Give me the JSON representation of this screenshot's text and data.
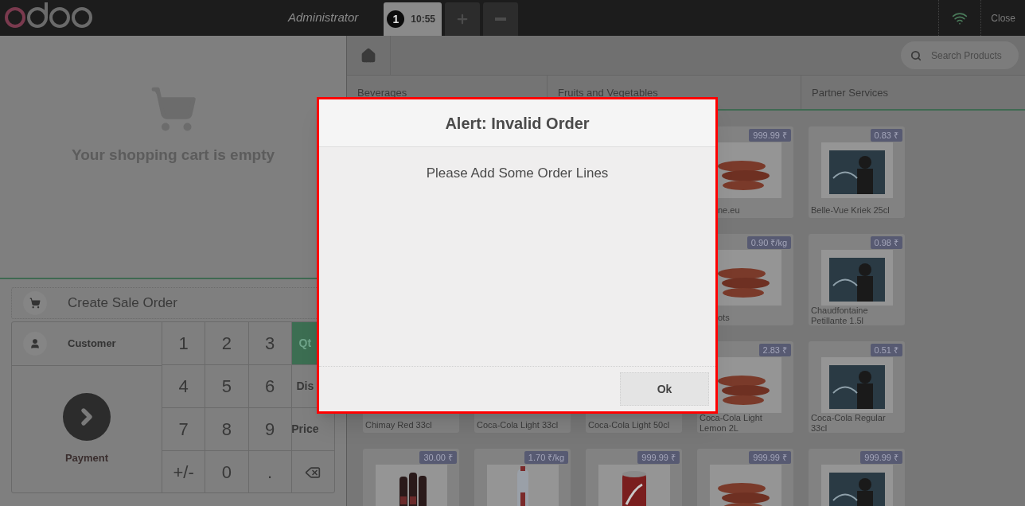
{
  "topbar": {
    "user": "Administrator",
    "orders": [
      {
        "number": "1",
        "time": "10:55",
        "selected": true
      }
    ],
    "close": "Close"
  },
  "cart": {
    "empty_message": "Your shopping cart is empty"
  },
  "actions": {
    "create_sale_order": "Create Sale Order",
    "customer": "Customer",
    "payment": "Payment"
  },
  "numpad": [
    {
      "kind": "key",
      "label": "1"
    },
    {
      "kind": "key",
      "label": "2"
    },
    {
      "kind": "key",
      "label": "3"
    },
    {
      "kind": "mode",
      "label": "Qt",
      "selected": true
    },
    {
      "kind": "key",
      "label": "4"
    },
    {
      "kind": "key",
      "label": "5"
    },
    {
      "kind": "key",
      "label": "6"
    },
    {
      "kind": "mode",
      "label": "Dis",
      "selected": false
    },
    {
      "kind": "key",
      "label": "7"
    },
    {
      "kind": "key",
      "label": "8"
    },
    {
      "kind": "key",
      "label": "9"
    },
    {
      "kind": "mode",
      "label": "Price",
      "selected": false
    },
    {
      "kind": "key",
      "label": "+/-"
    },
    {
      "kind": "key",
      "label": "0"
    },
    {
      "kind": "key",
      "label": "."
    },
    {
      "kind": "backspace"
    }
  ],
  "products_pane": {
    "search": {
      "placeholder": "Search Products"
    },
    "categories": [
      "Beverages",
      "Fruits and Vegetables",
      "Partner Services"
    ],
    "products": [
      {
        "kind": "covered"
      },
      {
        "kind": "covered"
      },
      {
        "kind": "covered"
      },
      {
        "kind": "partial",
        "price": "999.99 ₹",
        "name": "ne.eu"
      },
      {
        "kind": "card",
        "price": "0.83 ₹",
        "name": "Belle-Vue Kriek 25cl"
      },
      {
        "kind": "covered"
      },
      {
        "kind": "covered"
      },
      {
        "kind": "covered"
      },
      {
        "kind": "partial",
        "price": "0.90 ₹/kg",
        "name": "ots"
      },
      {
        "kind": "card",
        "price": "0.98 ₹",
        "name": "Chaudfontaine Petillante 1.5l"
      },
      {
        "kind": "label_only",
        "name": "Chimay Red 33cl"
      },
      {
        "kind": "label_only",
        "name": "Coca-Cola Light 33cl"
      },
      {
        "kind": "label_only",
        "name": "Coca-Cola Light 50cl"
      },
      {
        "kind": "card",
        "price": "2.83 ₹",
        "name": "Coca-Cola Light Lemon 2L"
      },
      {
        "kind": "card",
        "price": "0.51 ₹",
        "name": "Coca-Cola Regular 33cl"
      },
      {
        "kind": "card",
        "price": "30.00 ₹"
      },
      {
        "kind": "card",
        "price": "1.70 ₹/kg"
      },
      {
        "kind": "card",
        "price": "999.99 ₹"
      },
      {
        "kind": "card",
        "price": "999.99 ₹"
      },
      {
        "kind": "card",
        "price": "999.99 ₹"
      }
    ]
  },
  "dialog": {
    "title": "Alert: Invalid Order",
    "message": "Please Add Some Order Lines",
    "ok": "Ok"
  }
}
